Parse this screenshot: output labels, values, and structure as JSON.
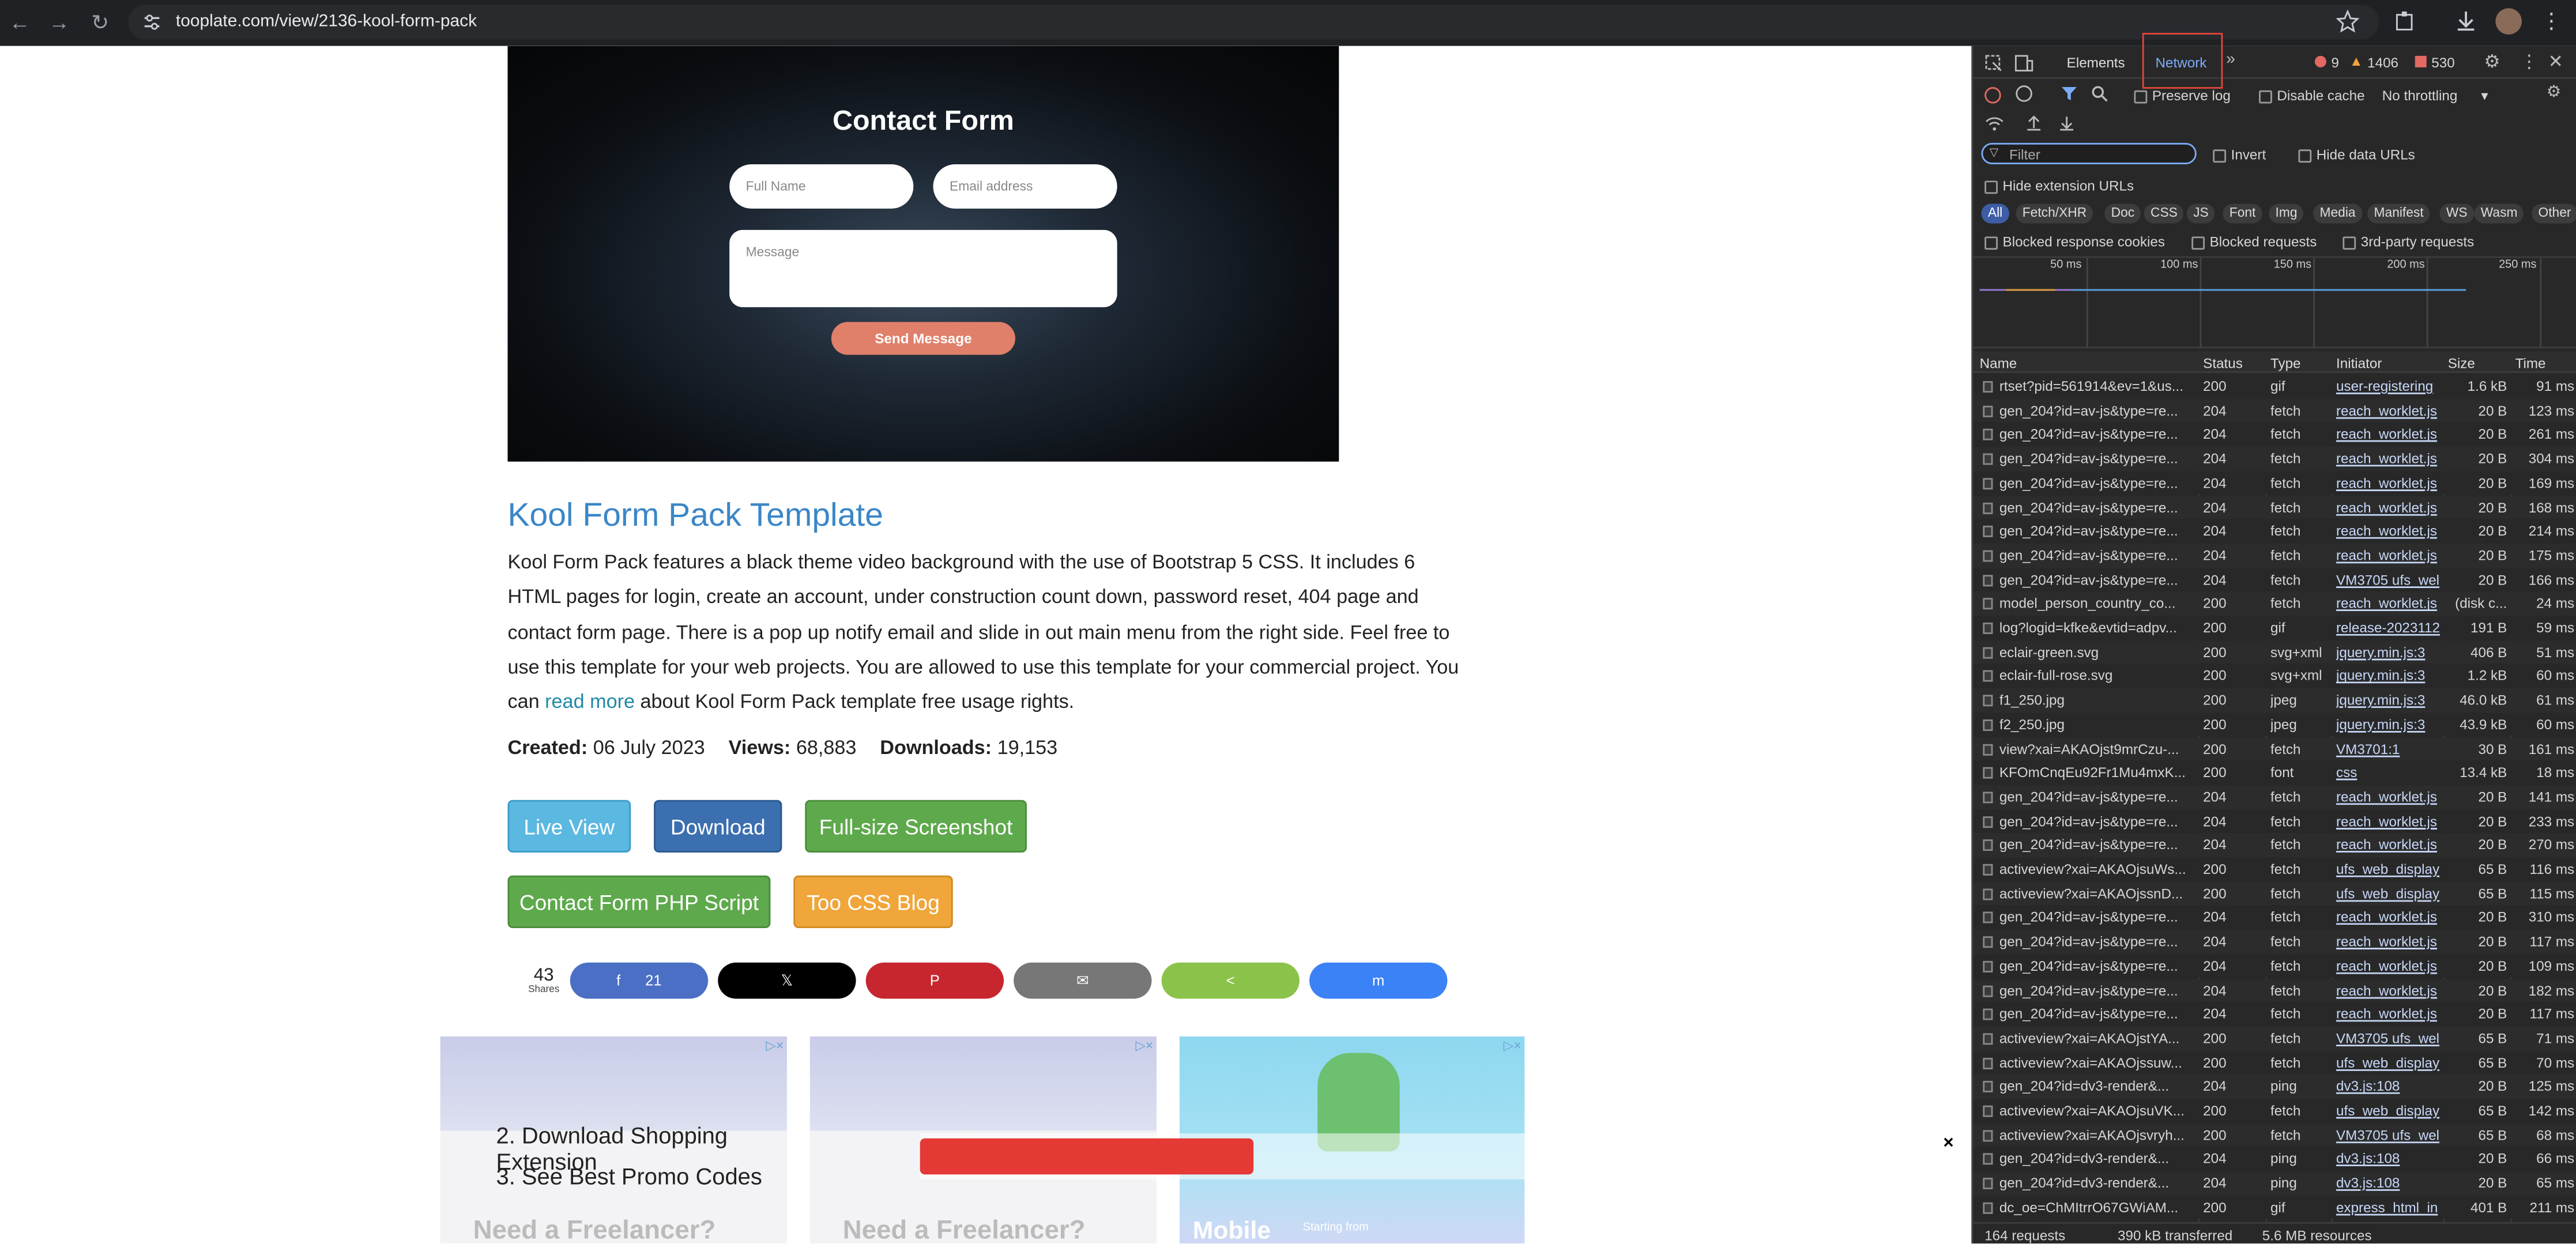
{
  "browser": {
    "url": "tooplate.com/view/2136-kool-form-pack",
    "back_icon": "←",
    "forward_icon": "→",
    "reload_icon": "↻"
  },
  "hero": {
    "title": "Contact Form",
    "name_placeholder": "Full Name",
    "email_placeholder": "Email address",
    "message_placeholder": "Message",
    "send_label": "Send Message"
  },
  "article": {
    "title": "Kool Form Pack Template",
    "desc_before_link": "Kool Form Pack features a black theme video background with the use of Bootstrap 5 CSS. It includes 6 HTML pages for login, create an account, under construction count down, password reset, 404 page and contact form page. There is a pop up notify email and slide in out main menu from the right side. Feel free to use this template for your web projects. You are allowed to use this template for your commercial project. You can ",
    "desc_link": "read more",
    "desc_after_link": " about Kool Form Pack template free usage rights.",
    "created_label": "Created:",
    "created_value": "06 July 2023",
    "views_label": "Views:",
    "views_value": "68,883",
    "downloads_label": "Downloads:",
    "downloads_value": "19,153"
  },
  "buttons": {
    "live_view": "Live View",
    "download": "Download",
    "full_screenshot": "Full-size Screenshot",
    "php_script": "Contact Form PHP Script",
    "css_blog": "Too CSS Blog"
  },
  "share": {
    "count": "43",
    "count_label": "Shares",
    "facebook_icon": "f",
    "facebook_count": "21",
    "x_icon": "𝕏",
    "pinterest_icon": "P",
    "email_icon": "✉",
    "sharethis_icon": "<",
    "messenger_icon": "m"
  },
  "ads": {
    "line2": "2. Download Shopping Extension",
    "line3": "3. See Best Promo Codes",
    "freelancer": "Need a Freelancer?",
    "mobile": "Mobile",
    "starting": "Starting from",
    "close_icon": "×",
    "badge_icon": "▷×"
  },
  "devtools": {
    "tabs": {
      "elements": "Elements",
      "network": "Network",
      "more": "»"
    },
    "counts": {
      "errors": "9",
      "warnings": "1406",
      "info": "530"
    },
    "toolbar": {
      "preserve_log": "Preserve log",
      "disable_cache": "Disable cache",
      "throttling": "No throttling"
    },
    "filter_placeholder": "Filter",
    "invert": "Invert",
    "hide_data_urls": "Hide data URLs",
    "hide_extension_urls": "Hide extension URLs",
    "type_filters": [
      "All",
      "Fetch/XHR",
      "Doc",
      "CSS",
      "JS",
      "Font",
      "Img",
      "Media",
      "Manifest",
      "WS",
      "Wasm",
      "Other"
    ],
    "blocked_cookies": "Blocked response cookies",
    "blocked_requests": "Blocked requests",
    "third_party": "3rd-party requests",
    "timeline_ticks": [
      "50 ms",
      "100 ms",
      "150 ms",
      "200 ms",
      "250 ms"
    ],
    "columns": {
      "name": "Name",
      "status": "Status",
      "type": "Type",
      "initiator": "Initiator",
      "size": "Size",
      "time": "Time"
    },
    "rows": [
      {
        "name": "rtset?pid=561914&ev=1&us...",
        "status": "200",
        "type": "gif",
        "initiator": "user-registering",
        "size": "1.6 kB",
        "time": "91 ms"
      },
      {
        "name": "gen_204?id=av-js&type=re...",
        "status": "204",
        "type": "fetch",
        "initiator": "reach_worklet.js",
        "size": "20 B",
        "time": "123 ms"
      },
      {
        "name": "gen_204?id=av-js&type=re...",
        "status": "204",
        "type": "fetch",
        "initiator": "reach_worklet.js",
        "size": "20 B",
        "time": "261 ms"
      },
      {
        "name": "gen_204?id=av-js&type=re...",
        "status": "204",
        "type": "fetch",
        "initiator": "reach_worklet.js",
        "size": "20 B",
        "time": "304 ms"
      },
      {
        "name": "gen_204?id=av-js&type=re...",
        "status": "204",
        "type": "fetch",
        "initiator": "reach_worklet.js",
        "size": "20 B",
        "time": "169 ms"
      },
      {
        "name": "gen_204?id=av-js&type=re...",
        "status": "204",
        "type": "fetch",
        "initiator": "reach_worklet.js",
        "size": "20 B",
        "time": "168 ms"
      },
      {
        "name": "gen_204?id=av-js&type=re...",
        "status": "204",
        "type": "fetch",
        "initiator": "reach_worklet.js",
        "size": "20 B",
        "time": "214 ms"
      },
      {
        "name": "gen_204?id=av-js&type=re...",
        "status": "204",
        "type": "fetch",
        "initiator": "reach_worklet.js",
        "size": "20 B",
        "time": "175 ms"
      },
      {
        "name": "gen_204?id=av-js&type=re...",
        "status": "204",
        "type": "fetch",
        "initiator": "VM3705 ufs_wel",
        "size": "20 B",
        "time": "166 ms"
      },
      {
        "name": "model_person_country_co...",
        "status": "200",
        "type": "fetch",
        "initiator": "reach_worklet.js",
        "size": "(disk c...",
        "time": "24 ms"
      },
      {
        "name": "log?logid=kfke&evtid=adpv...",
        "status": "200",
        "type": "gif",
        "initiator": "release-2023112",
        "size": "191 B",
        "time": "59 ms"
      },
      {
        "name": "eclair-green.svg",
        "status": "200",
        "type": "svg+xml",
        "initiator": "jquery.min.js:3",
        "size": "406 B",
        "time": "51 ms"
      },
      {
        "name": "eclair-full-rose.svg",
        "status": "200",
        "type": "svg+xml",
        "initiator": "jquery.min.js:3",
        "size": "1.2 kB",
        "time": "60 ms"
      },
      {
        "name": "f1_250.jpg",
        "status": "200",
        "type": "jpeg",
        "initiator": "jquery.min.js:3",
        "size": "46.0 kB",
        "time": "61 ms"
      },
      {
        "name": "f2_250.jpg",
        "status": "200",
        "type": "jpeg",
        "initiator": "jquery.min.js:3",
        "size": "43.9 kB",
        "time": "60 ms"
      },
      {
        "name": "view?xai=AKAOjst9mrCzu-...",
        "status": "200",
        "type": "fetch",
        "initiator": "VM3701:1",
        "size": "30 B",
        "time": "161 ms"
      },
      {
        "name": "KFOmCnqEu92Fr1Mu4mxK...",
        "status": "200",
        "type": "font",
        "initiator": "css",
        "size": "13.4 kB",
        "time": "18 ms"
      },
      {
        "name": "gen_204?id=av-js&type=re...",
        "status": "204",
        "type": "fetch",
        "initiator": "reach_worklet.js",
        "size": "20 B",
        "time": "141 ms"
      },
      {
        "name": "gen_204?id=av-js&type=re...",
        "status": "204",
        "type": "fetch",
        "initiator": "reach_worklet.js",
        "size": "20 B",
        "time": "233 ms"
      },
      {
        "name": "gen_204?id=av-js&type=re...",
        "status": "204",
        "type": "fetch",
        "initiator": "reach_worklet.js",
        "size": "20 B",
        "time": "270 ms"
      },
      {
        "name": "activeview?xai=AKAOjsuWs...",
        "status": "200",
        "type": "fetch",
        "initiator": "ufs_web_display",
        "size": "65 B",
        "time": "116 ms"
      },
      {
        "name": "activeview?xai=AKAOjssnD...",
        "status": "200",
        "type": "fetch",
        "initiator": "ufs_web_display",
        "size": "65 B",
        "time": "115 ms"
      },
      {
        "name": "gen_204?id=av-js&type=re...",
        "status": "204",
        "type": "fetch",
        "initiator": "reach_worklet.js",
        "size": "20 B",
        "time": "310 ms"
      },
      {
        "name": "gen_204?id=av-js&type=re...",
        "status": "204",
        "type": "fetch",
        "initiator": "reach_worklet.js",
        "size": "20 B",
        "time": "117 ms"
      },
      {
        "name": "gen_204?id=av-js&type=re...",
        "status": "204",
        "type": "fetch",
        "initiator": "reach_worklet.js",
        "size": "20 B",
        "time": "109 ms"
      },
      {
        "name": "gen_204?id=av-js&type=re...",
        "status": "204",
        "type": "fetch",
        "initiator": "reach_worklet.js",
        "size": "20 B",
        "time": "182 ms"
      },
      {
        "name": "gen_204?id=av-js&type=re...",
        "status": "204",
        "type": "fetch",
        "initiator": "reach_worklet.js",
        "size": "20 B",
        "time": "117 ms"
      },
      {
        "name": "activeview?xai=AKAOjstYA...",
        "status": "200",
        "type": "fetch",
        "initiator": "VM3705 ufs_wel",
        "size": "65 B",
        "time": "71 ms"
      },
      {
        "name": "activeview?xai=AKAOjssuw...",
        "status": "200",
        "type": "fetch",
        "initiator": "ufs_web_display",
        "size": "65 B",
        "time": "70 ms"
      },
      {
        "name": "gen_204?id=dv3-render&...",
        "status": "204",
        "type": "ping",
        "initiator": "dv3.js:108",
        "size": "20 B",
        "time": "125 ms"
      },
      {
        "name": "activeview?xai=AKAOjsuVK...",
        "status": "200",
        "type": "fetch",
        "initiator": "ufs_web_display",
        "size": "65 B",
        "time": "142 ms"
      },
      {
        "name": "activeview?xai=AKAOjsvryh...",
        "status": "200",
        "type": "fetch",
        "initiator": "VM3705 ufs_wel",
        "size": "65 B",
        "time": "68 ms"
      },
      {
        "name": "gen_204?id=dv3-render&...",
        "status": "204",
        "type": "ping",
        "initiator": "dv3.js:108",
        "size": "20 B",
        "time": "66 ms"
      },
      {
        "name": "gen_204?id=dv3-render&...",
        "status": "204",
        "type": "ping",
        "initiator": "dv3.js:108",
        "size": "20 B",
        "time": "65 ms"
      },
      {
        "name": "dc_oe=ChMItrrO67GWiAM...",
        "status": "200",
        "type": "gif",
        "initiator": "express_html_in",
        "size": "401 B",
        "time": "211 ms"
      }
    ],
    "summary": {
      "requests": "164 requests",
      "transferred": "390 kB transferred",
      "resources": "5.6 MB resources"
    }
  }
}
